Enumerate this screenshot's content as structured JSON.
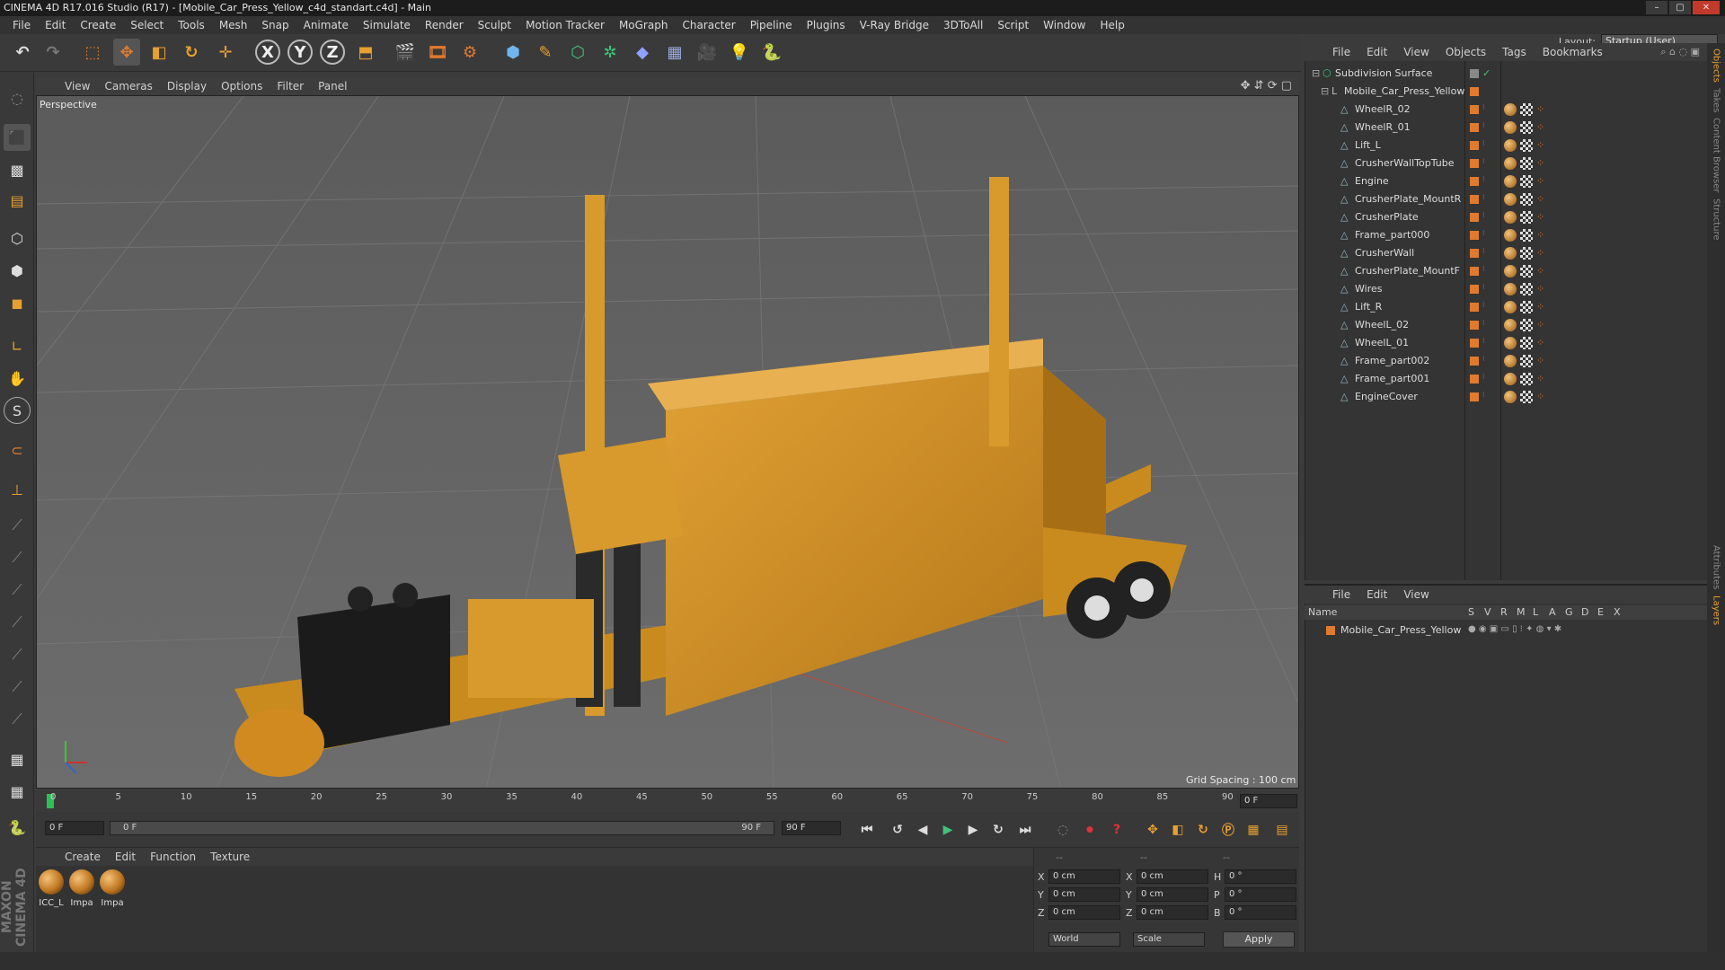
{
  "window": {
    "title": "CINEMA 4D R17.016 Studio (R17) - [Mobile_Car_Press_Yellow_c4d_standart.c4d] - Main",
    "min": "–",
    "max": "▢",
    "close": "✕"
  },
  "menubar": [
    "File",
    "Edit",
    "Create",
    "Select",
    "Tools",
    "Mesh",
    "Snap",
    "Animate",
    "Simulate",
    "Render",
    "Sculpt",
    "Motion Tracker",
    "MoGraph",
    "Character",
    "Pipeline",
    "Plugins",
    "V-Ray Bridge",
    "3DToAll",
    "Script",
    "Window",
    "Help"
  ],
  "layout": {
    "label": "Layout:",
    "value": "Startup (User)"
  },
  "viewport": {
    "menu": [
      "View",
      "Cameras",
      "Display",
      "Options",
      "Filter",
      "Panel"
    ],
    "label": "Perspective",
    "grid_spacing": "Grid Spacing : 100 cm"
  },
  "timeline": {
    "ticks": [
      "0",
      "5",
      "10",
      "15",
      "20",
      "25",
      "30",
      "35",
      "40",
      "45",
      "50",
      "55",
      "60",
      "65",
      "70",
      "75",
      "80",
      "85",
      "90"
    ],
    "current_frame": "0 F"
  },
  "transport": {
    "start": "0 F",
    "range_start": "0 F",
    "range_end": "90 F",
    "end": "90 F"
  },
  "material_menu": [
    "Create",
    "Edit",
    "Function",
    "Texture"
  ],
  "materials": [
    {
      "name": "ICC_L"
    },
    {
      "name": "Impa"
    },
    {
      "name": "Impa"
    }
  ],
  "coords": {
    "headers": [
      "--",
      "--",
      "--"
    ],
    "rows": [
      {
        "a": "X",
        "v1": "0 cm",
        "b": "X",
        "v2": "0 cm",
        "c": "H",
        "v3": "0 °"
      },
      {
        "a": "Y",
        "v1": "0 cm",
        "b": "Y",
        "v2": "0 cm",
        "c": "P",
        "v3": "0 °"
      },
      {
        "a": "Z",
        "v1": "0 cm",
        "b": "Z",
        "v2": "0 cm",
        "c": "B",
        "v3": "0 °"
      }
    ],
    "mode1": "World",
    "mode2": "Scale",
    "apply": "Apply"
  },
  "object_manager": {
    "menu": [
      "File",
      "Edit",
      "View",
      "Objects",
      "Tags",
      "Bookmarks"
    ],
    "root": "Subdivision Surface",
    "group": "Mobile_Car_Press_Yellow",
    "children": [
      "WheelR_02",
      "WheelR_01",
      "Lift_L",
      "CrusherWallTopTube",
      "Engine",
      "CrusherPlate_MountR",
      "CrusherPlate",
      "Frame_part000",
      "CrusherWall",
      "CrusherPlate_MountF",
      "Wires",
      "Lift_R",
      "WheelL_02",
      "WheelL_01",
      "Frame_part002",
      "Frame_part001",
      "EngineCover"
    ]
  },
  "layer_manager": {
    "menu": [
      "File",
      "Edit",
      "View"
    ],
    "columns": [
      "Name",
      "S",
      "V",
      "R",
      "M",
      "L",
      "A",
      "G",
      "D",
      "E",
      "X"
    ],
    "layers": [
      "Mobile_Car_Press_Yellow"
    ]
  },
  "side_tabs": [
    "Objects",
    "Takes",
    "Content Browser",
    "Structure",
    "Attributes",
    "Layers"
  ],
  "colors": {
    "accent": "#e07a2e",
    "object_color": "#e8a030",
    "model": "#c98a1e"
  }
}
